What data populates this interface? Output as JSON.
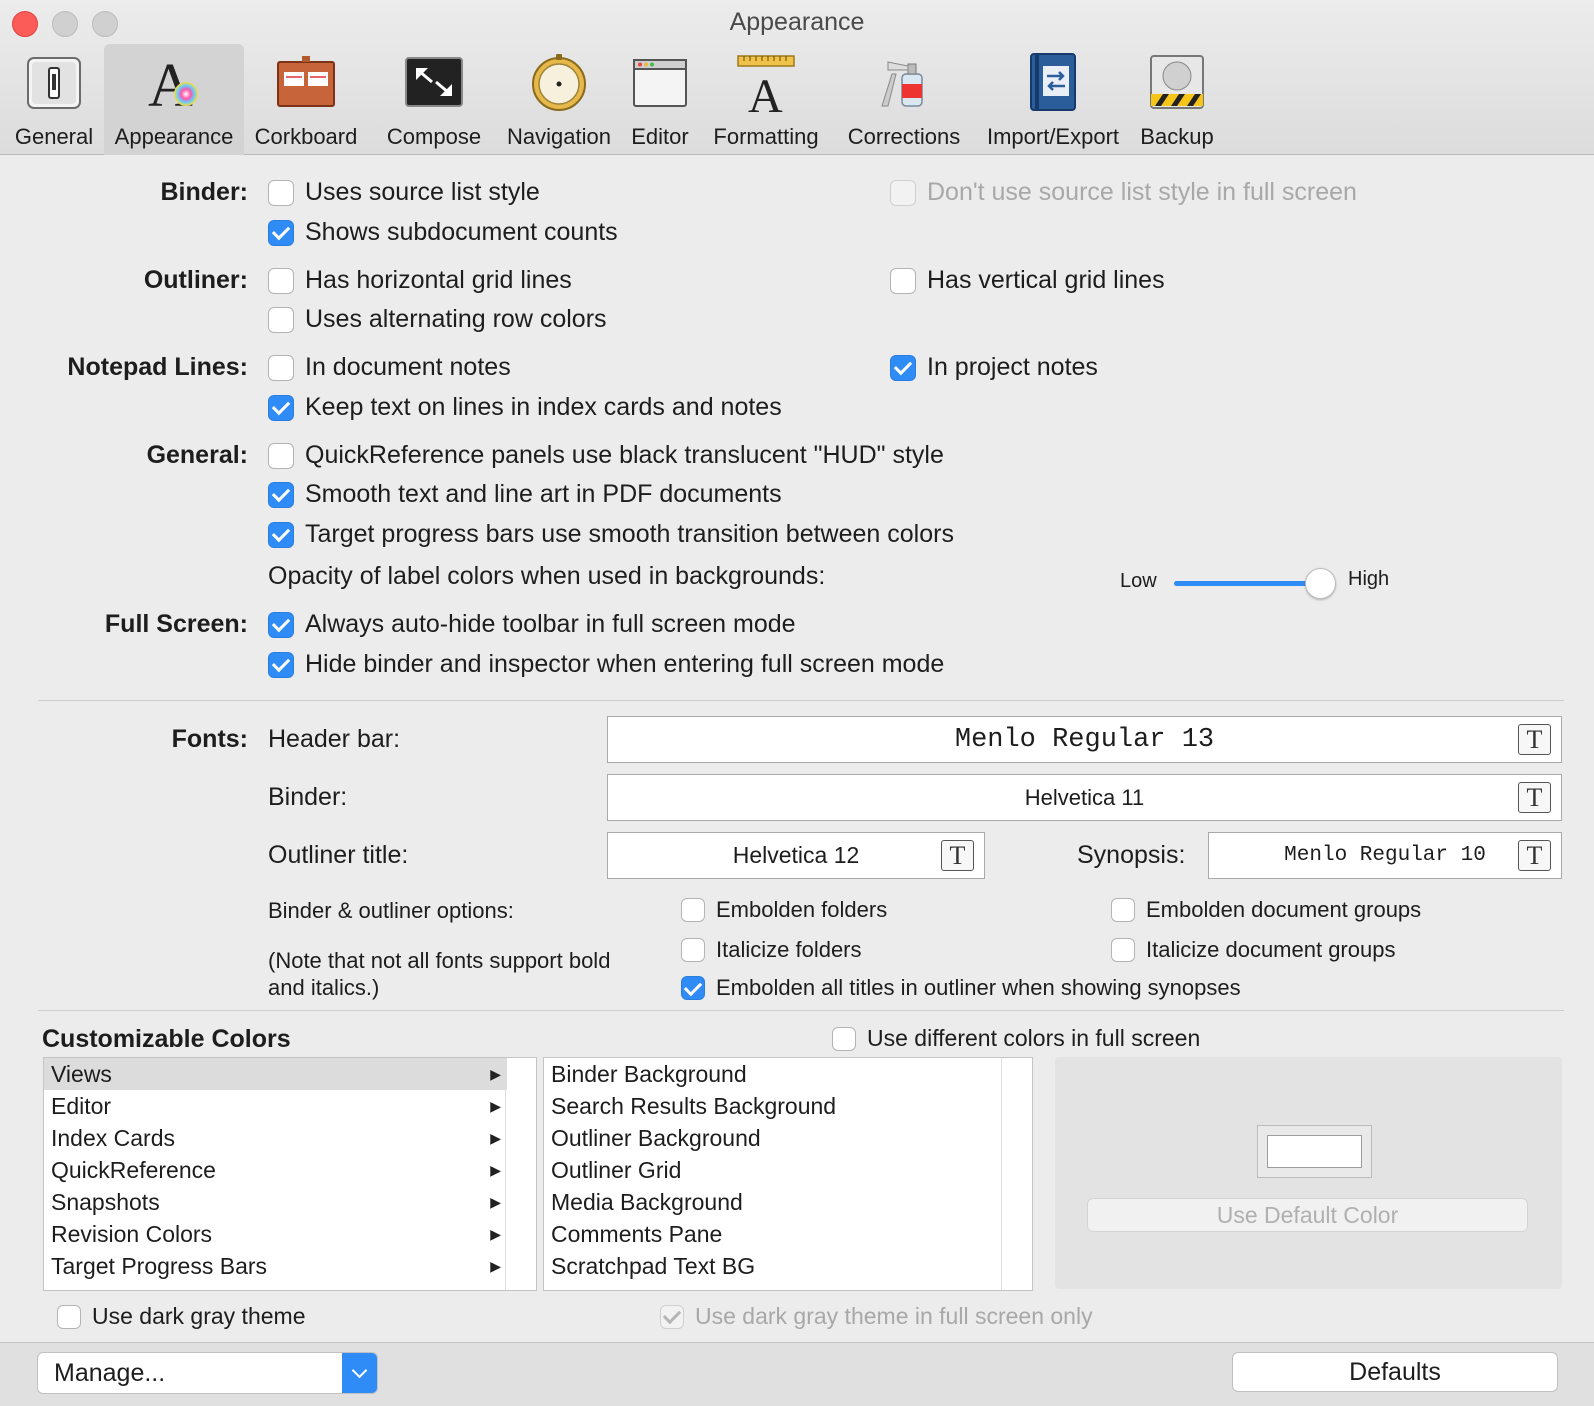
{
  "window": {
    "title": "Appearance"
  },
  "toolbar": {
    "items": [
      {
        "label": "General",
        "icon": "switch-icon"
      },
      {
        "label": "Appearance",
        "icon": "font-color-icon",
        "selected": true
      },
      {
        "label": "Corkboard",
        "icon": "corkboard-icon"
      },
      {
        "label": "Compose",
        "icon": "compose-icon"
      },
      {
        "label": "Navigation",
        "icon": "compass-icon"
      },
      {
        "label": "Editor",
        "icon": "window-icon"
      },
      {
        "label": "Formatting",
        "icon": "ruler-font-icon"
      },
      {
        "label": "Corrections",
        "icon": "spray-bottle-icon"
      },
      {
        "label": "Import/Export",
        "icon": "notebook-arrows-icon"
      },
      {
        "label": "Backup",
        "icon": "drive-backup-icon"
      }
    ]
  },
  "binder": {
    "label": "Binder:",
    "uses_source_list_style": {
      "label": "Uses source list style",
      "checked": false
    },
    "dont_use_source_list_full_screen": {
      "label": "Don't use source list style in full screen",
      "checked": false,
      "disabled": true
    },
    "shows_subdocument_counts": {
      "label": "Shows subdocument counts",
      "checked": true
    }
  },
  "outliner": {
    "label": "Outliner:",
    "horizontal_grid": {
      "label": "Has horizontal grid lines",
      "checked": false
    },
    "vertical_grid": {
      "label": "Has vertical grid lines",
      "checked": false
    },
    "alternating_rows": {
      "label": "Uses alternating row colors",
      "checked": false
    }
  },
  "notepad": {
    "label": "Notepad Lines:",
    "document_notes": {
      "label": "In document notes",
      "checked": false
    },
    "project_notes": {
      "label": "In project notes",
      "checked": true
    },
    "keep_text_on_lines": {
      "label": "Keep text on lines in index cards and notes",
      "checked": true
    }
  },
  "general": {
    "label": "General:",
    "hud_style": {
      "label": "QuickReference panels use black translucent \"HUD\" style",
      "checked": false
    },
    "smooth_pdf": {
      "label": "Smooth text and line art in PDF documents",
      "checked": true
    },
    "smooth_progress": {
      "label": "Target progress bars use smooth transition between colors",
      "checked": true
    },
    "opacity_label": "Opacity of label colors when used in backgrounds:",
    "opacity_low": "Low",
    "opacity_high": "High",
    "opacity_value": 1.0
  },
  "full_screen": {
    "label": "Full Screen:",
    "auto_hide_toolbar": {
      "label": "Always auto-hide toolbar in full screen mode",
      "checked": true
    },
    "hide_binder_inspector": {
      "label": "Hide binder and inspector when entering full screen mode",
      "checked": true
    }
  },
  "fonts": {
    "label": "Fonts:",
    "header_bar_label": "Header bar:",
    "header_bar_value": "Menlo Regular 13",
    "binder_label": "Binder:",
    "binder_value": "Helvetica 11",
    "outliner_title_label": "Outliner title:",
    "outliner_title_value": "Helvetica 12",
    "synopsis_label": "Synopsis:",
    "synopsis_value": "Menlo Regular 10",
    "font_button_glyph": "T",
    "options_label": "Binder & outliner options:",
    "note_line1": "(Note that not all fonts support bold",
    "note_line2": "and italics.)",
    "embolden_folders": {
      "label": "Embolden folders",
      "checked": false
    },
    "embolden_groups": {
      "label": "Embolden document groups",
      "checked": false
    },
    "italicize_folders": {
      "label": "Italicize folders",
      "checked": false
    },
    "italicize_groups": {
      "label": "Italicize document groups",
      "checked": false
    },
    "embolden_titles_synopses": {
      "label": "Embolden all titles in outliner when showing synopses",
      "checked": true
    }
  },
  "colors": {
    "title": "Customizable Colors",
    "different_full_screen": {
      "label": "Use different colors in full screen",
      "checked": false
    },
    "categories": [
      "Views",
      "Editor",
      "Index Cards",
      "QuickReference",
      "Snapshots",
      "Revision Colors",
      "Target Progress Bars"
    ],
    "selected_category": 0,
    "category_arrow": "▶",
    "items": [
      "Binder Background",
      "Search Results Background",
      "Outliner Background",
      "Outliner Grid",
      "Media Background",
      "Comments Pane",
      "Scratchpad Text BG"
    ],
    "use_default_color": "Use Default Color",
    "dark_gray_theme": {
      "label": "Use dark gray theme",
      "checked": false
    },
    "dark_gray_full_screen_only": {
      "label": "Use dark gray theme in full screen only",
      "checked": true,
      "disabled": true
    }
  },
  "bottom": {
    "manage_label": "Manage...",
    "defaults_label": "Defaults"
  },
  "accent_color": "#2f8cf6"
}
